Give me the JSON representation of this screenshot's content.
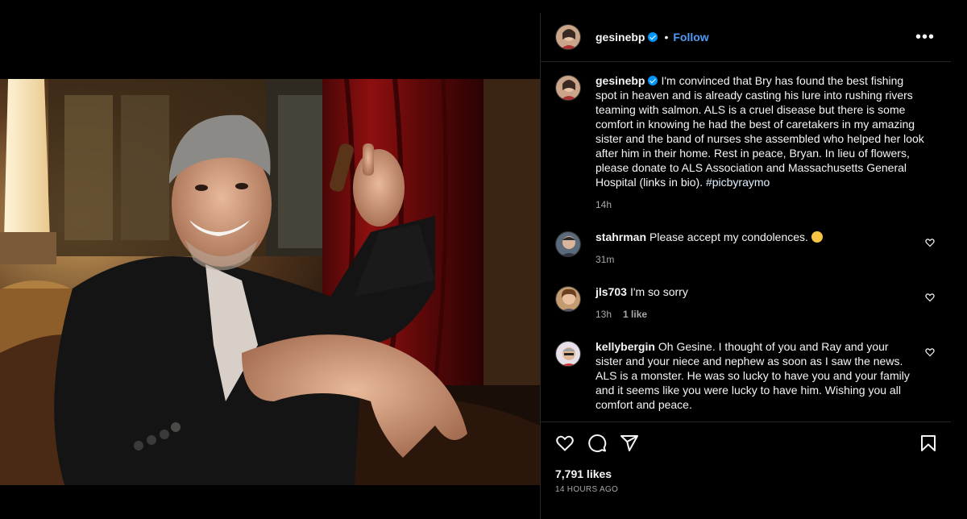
{
  "post": {
    "author": "gesinebp",
    "follow_label": "Follow",
    "separator": "•",
    "more_label": "•••",
    "caption": "I'm convinced that Bry has found the best fishing spot in heaven and is already casting his lure into rushing rivers teaming with salmon. ALS is a cruel disease but there is some comfort in knowing he had the best of caretakers in my amazing sister and the band of nurses she assembled who helped her look after him in their home. Rest in peace, Bryan. In lieu of flowers, please donate to ALS Association and Massachusetts General Hospital (links in bio).",
    "hashtag": "#picbyraymo",
    "caption_time": "14h",
    "likes": "7,791 likes",
    "posted": "14 HOURS AGO"
  },
  "comments": [
    {
      "user": "stahrman",
      "text": "Please accept my condolences.",
      "emoji": "sad-face-emoji",
      "time": "31m",
      "likes": ""
    },
    {
      "user": "jls703",
      "text": "I'm so sorry",
      "time": "13h",
      "likes": "1 like"
    },
    {
      "user": "kellybergin",
      "text": "Oh Gesine. I thought of you and Ray and your sister and your niece and nephew as soon as I saw the news. ALS is a monster. He was so lucky to have you and your family and it seems like you were lucky to have him. Wishing you all comfort and peace.",
      "time": "",
      "likes": ""
    }
  ],
  "icons": {
    "verified": "verified-badge-icon",
    "like": "heart-icon",
    "comment": "comment-bubble-icon",
    "share": "send-paper-plane-icon",
    "save": "bookmark-icon"
  },
  "colors": {
    "background": "#000000",
    "link": "#4e9cf5",
    "verified": "#0095f6",
    "muted": "#a8a8a8"
  }
}
